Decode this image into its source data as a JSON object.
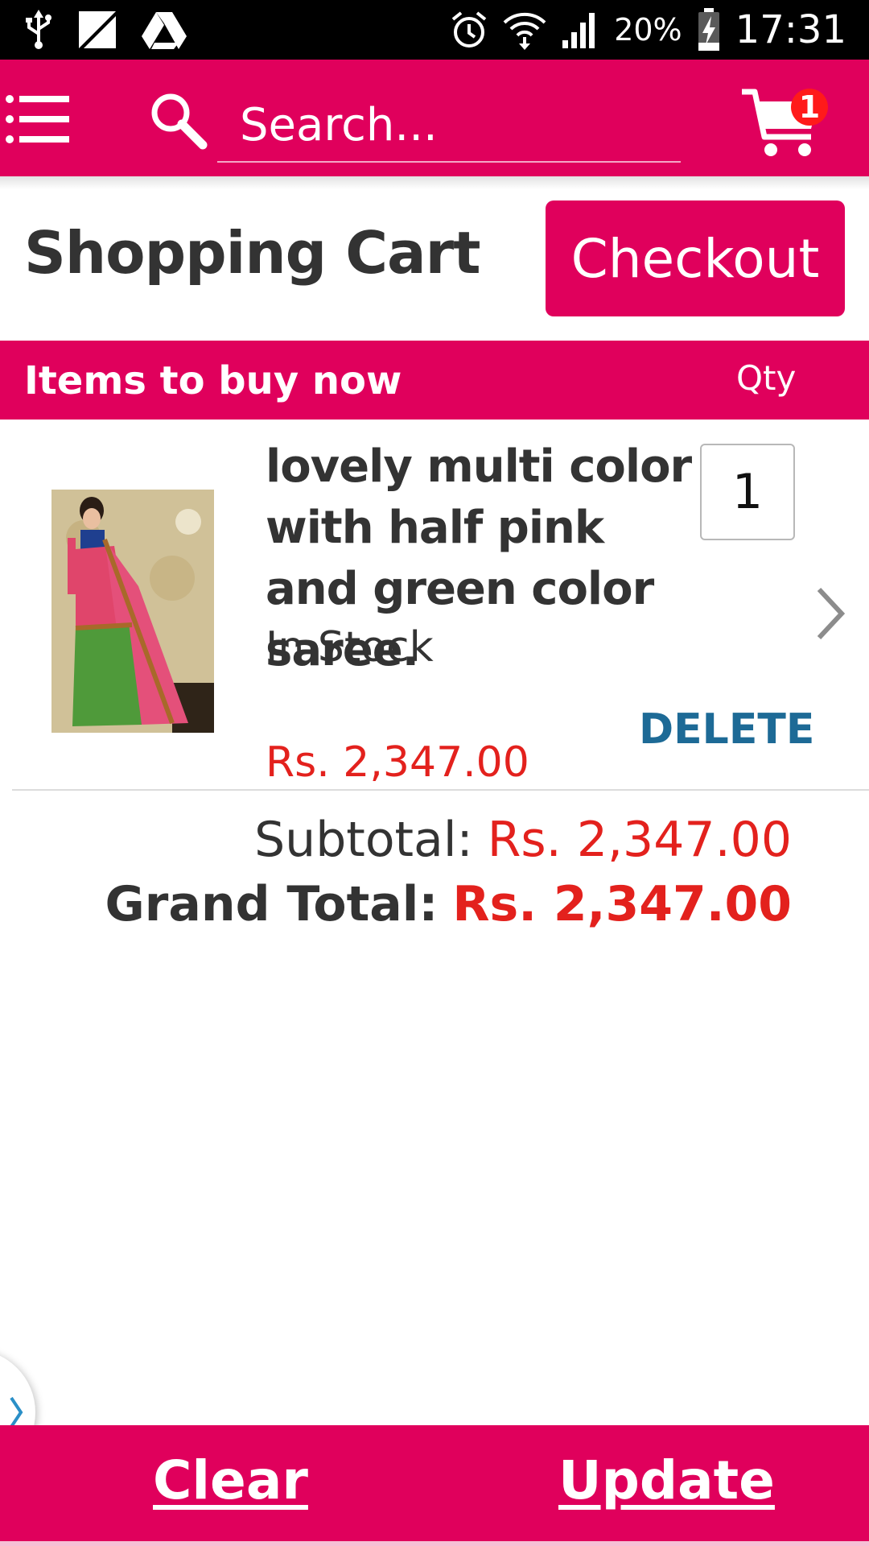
{
  "status_bar": {
    "battery_percent": "20%",
    "time": "17:31",
    "icons": [
      "usb-icon",
      "no-sim-icon",
      "drive-icon",
      "alarm-icon",
      "wifi-icon",
      "signal-icon",
      "battery-charging-icon"
    ]
  },
  "app_bar": {
    "search_placeholder": "Search...",
    "cart_count": "1",
    "icons": [
      "menu-icon",
      "search-icon",
      "cart-icon"
    ]
  },
  "header": {
    "title": "Shopping Cart",
    "checkout_label": "Checkout"
  },
  "section": {
    "title": "Items to buy now",
    "qty_label": "Qty"
  },
  "cart_items": [
    {
      "name": "lovely multi color with half pink and green color saree.",
      "stock": "In Stock",
      "quantity": "1",
      "price": "Rs. 2,347.00",
      "delete_label": "DELETE"
    }
  ],
  "totals": {
    "subtotal_label": "Subtotal:",
    "subtotal_value": "Rs. 2,347.00",
    "grand_total_label": "Grand Total:",
    "grand_total_value": "Rs. 2,347.00"
  },
  "bottom_bar": {
    "clear_label": "Clear",
    "update_label": "Update"
  },
  "colors": {
    "brand": "#e0005c",
    "price": "#e3211d",
    "delete": "#1d6a96",
    "text": "#333333"
  }
}
